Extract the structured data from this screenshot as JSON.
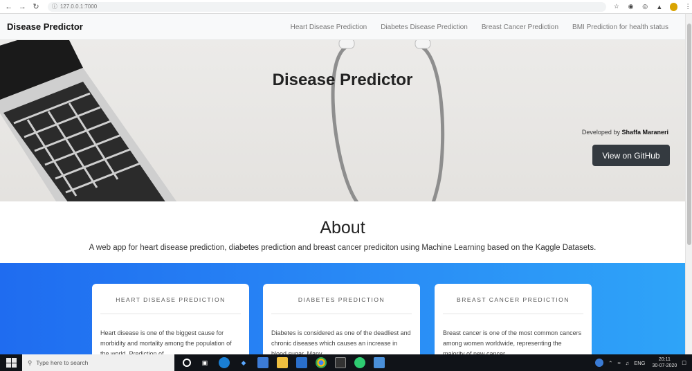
{
  "browser": {
    "back_icon": "arrow-left-icon",
    "forward_icon": "arrow-right-icon",
    "reload_icon": "reload-icon",
    "url": "127.0.0.1:7000"
  },
  "navbar": {
    "brand": "Disease Predictor",
    "links": [
      "Heart Disease Prediction",
      "Diabetes Disease Prediction",
      "Breast Cancer Prediction",
      "BMI Prediction for health status"
    ]
  },
  "hero": {
    "title": "Disease Predictor",
    "developed_by_label": "Developed by",
    "developer_name": "Shaffa Maraneri",
    "github_button": "View on GitHub"
  },
  "about": {
    "title": "About",
    "text": "A web app for heart disease prediction, diabetes prediction and breast cancer prediciton using Machine Learning based on the Kaggle Datasets."
  },
  "cards": [
    {
      "title": "HEART DISEASE PREDICTION",
      "text": "Heart disease is one of the biggest cause for morbidity and mortality among the population of the world. Prediction of"
    },
    {
      "title": "DIABETES PREDICTION",
      "text": "Diabetes is considered as one of the deadliest and chronic diseases which causes an increase in blood sugar. Many"
    },
    {
      "title": "BREAST CANCER PREDICTION",
      "text": "Breast cancer is one of the most common cancers among women worldwide, representing the majority of new cancer"
    }
  ],
  "taskbar": {
    "search_placeholder": "Type here to search",
    "language": "ENG",
    "time": "20:11",
    "date": "30-07-2020"
  },
  "colors": {
    "band_start": "#1f6cf0",
    "band_end": "#2ea4f8",
    "button_dark": "#343a40"
  }
}
